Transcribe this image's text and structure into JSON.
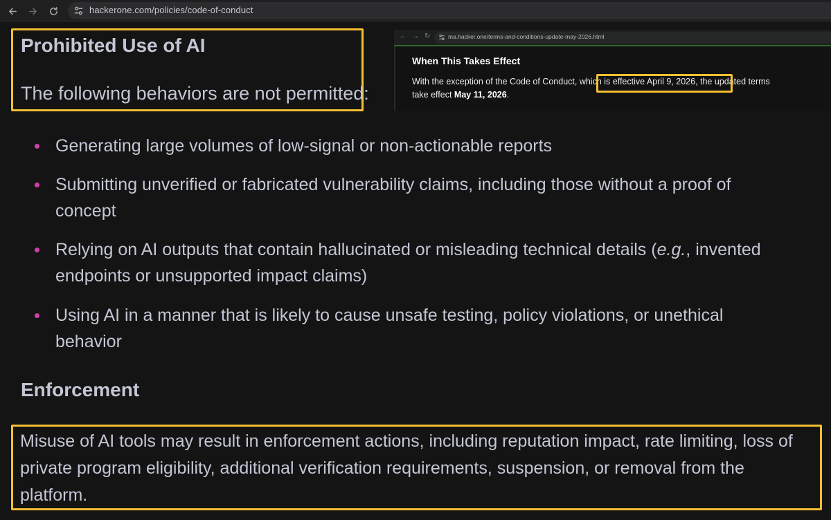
{
  "browser": {
    "back_icon": "arrow-left-icon",
    "forward_icon": "arrow-right-icon",
    "reload_icon": "reload-icon",
    "site_info_icon": "tune-icon",
    "url": "hackerone.com/policies/code-of-conduct"
  },
  "section": {
    "title": "Prohibited Use of AI",
    "intro": "The following behaviors are not permitted:",
    "bullets": [
      "Generating large volumes of low-signal or non-actionable reports",
      "Submitting unverified or fabricated vulnerability claims, including those without a proof of concept",
      {
        "before": "Relying on AI outputs that contain hallucinated or misleading technical details (",
        "italic": "e.g.",
        "after": ", invented endpoints or unsupported impact claims)"
      },
      "Using AI in a manner that is likely to cause unsafe testing, policy violations, or unethical behavior"
    ]
  },
  "enforcement": {
    "title": "Enforcement",
    "text": "Misuse of AI tools may result in enforcement actions, including reputation impact, rate limiting, loss of private program eligibility, additional verification requirements, suspension, or removal from the platform."
  },
  "inset": {
    "url": "ma.hacker.one/terms-and-conditions-update-may-2026.html",
    "heading": "When This Takes Effect",
    "line1_before": "With the exception of the Code of Conduct,",
    "line1_highlight": "which is effective April 9, 2026",
    "line1_after": ", the updated terms",
    "line2_before": "take effect ",
    "line2_bold": "May 11, 2026",
    "line2_after": "."
  },
  "colors": {
    "highlight_box": "#f4c032",
    "bullet": "#d23ea8",
    "text": "#c3c6d4",
    "background": "#141414"
  }
}
